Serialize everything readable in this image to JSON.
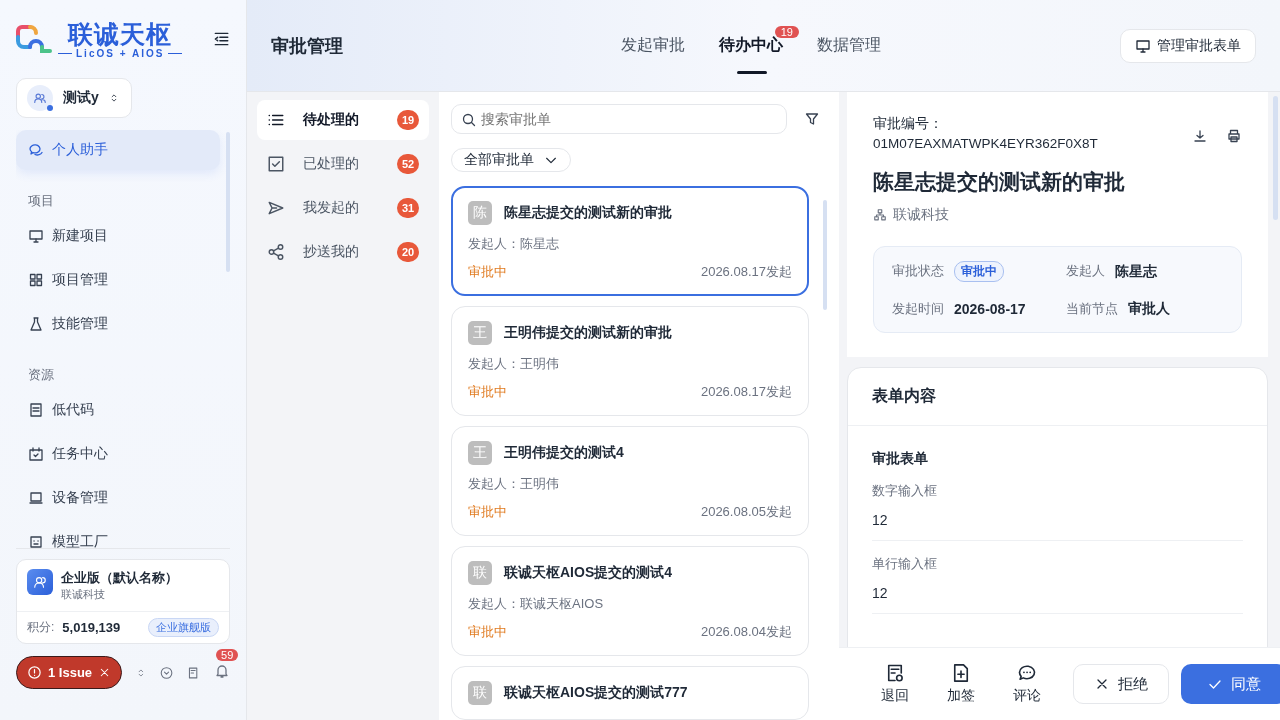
{
  "sidebar": {
    "logo": {
      "name": "联诚天枢",
      "tagline": "LicOS + AIOS"
    },
    "workspace": "测试y",
    "nav": [
      {
        "kind": "item",
        "label": "个人助手",
        "selected": true
      },
      {
        "kind": "heading",
        "label": "项目"
      },
      {
        "kind": "item",
        "label": "新建项目",
        "selected": false
      },
      {
        "kind": "item",
        "label": "项目管理",
        "selected": false
      },
      {
        "kind": "item",
        "label": "技能管理",
        "selected": false
      },
      {
        "kind": "heading",
        "label": "资源"
      },
      {
        "kind": "item",
        "label": "低代码",
        "selected": false
      },
      {
        "kind": "item",
        "label": "任务中心",
        "selected": false
      },
      {
        "kind": "item",
        "label": "设备管理",
        "selected": false
      },
      {
        "kind": "item",
        "label": "模型工厂",
        "selected": false
      }
    ],
    "org": {
      "name": "企业版（默认名称）",
      "company": "联诚科技",
      "points_label": "积分:",
      "points": "5,019,139",
      "plan": "企业旗舰版"
    },
    "issue": "1 Issue",
    "notifications": "59"
  },
  "header": {
    "title": "审批管理",
    "tabs": [
      {
        "label": "发起审批",
        "selected": false
      },
      {
        "label": "待办中心",
        "selected": true,
        "badge": "19"
      },
      {
        "label": "数据管理",
        "selected": false
      }
    ],
    "manage_button": "管理审批表单"
  },
  "filters": [
    {
      "label": "待处理的",
      "count": "19",
      "selected": true
    },
    {
      "label": "已处理的",
      "count": "52",
      "selected": false
    },
    {
      "label": "我发起的",
      "count": "31",
      "selected": false
    },
    {
      "label": "抄送我的",
      "count": "20",
      "selected": false
    }
  ],
  "list": {
    "search": {
      "placeholder": "搜索审批单"
    },
    "dropdown": "全部审批单",
    "cards": [
      {
        "avatar": "陈",
        "title": "陈星志提交的测试新的审批",
        "initiator": "发起人：陈星志",
        "status": "审批中",
        "date": "2026.08.17发起",
        "selected": true
      },
      {
        "avatar": "王",
        "title": "王明伟提交的测试新的审批",
        "initiator": "发起人：王明伟",
        "status": "审批中",
        "date": "2026.08.17发起",
        "selected": false
      },
      {
        "avatar": "王",
        "title": "王明伟提交的测试4",
        "initiator": "发起人：王明伟",
        "status": "审批中",
        "date": "2026.08.05发起",
        "selected": false
      },
      {
        "avatar": "联",
        "title": "联诚天枢AIOS提交的测试4",
        "initiator": "发起人：联诚天枢AIOS",
        "status": "审批中",
        "date": "2026.08.04发起",
        "selected": false
      },
      {
        "avatar": "联",
        "title": "联诚天枢AIOS提交的测试777",
        "selected": false
      }
    ]
  },
  "detail": {
    "id_label": "审批编号：",
    "id": "01M07EAXMATWPK4EYR362F0X8T",
    "title": "陈星志提交的测试新的审批",
    "company": "联诚科技",
    "info": [
      {
        "label": "审批状态",
        "value": "审批中",
        "kind": "tag"
      },
      {
        "label": "发起人",
        "value": "陈星志",
        "kind": "text"
      },
      {
        "label": "发起时间",
        "value": "2026-08-17",
        "kind": "text"
      },
      {
        "label": "当前节点",
        "value": "审批人",
        "kind": "text"
      }
    ],
    "form": {
      "title": "表单内容",
      "section": "审批表单",
      "fields": [
        {
          "label": "数字输入框",
          "value": "12"
        },
        {
          "label": "单行输入框",
          "value": "12"
        }
      ]
    },
    "actions": [
      "退回",
      "加签",
      "评论"
    ],
    "reject": "拒绝",
    "approve": "同意"
  }
}
